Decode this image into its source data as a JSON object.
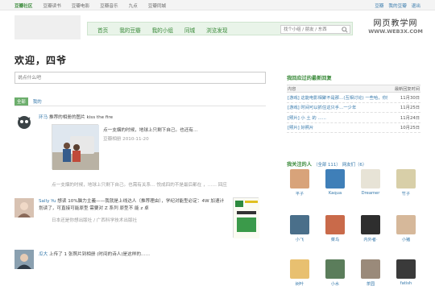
{
  "topbar": {
    "links": [
      "豆瓣社区",
      "豆瓣读书",
      "豆瓣电影",
      "豆瓣音乐",
      "九点",
      "豆瓣同城"
    ],
    "right": [
      "豆瓣",
      "我的豆瓣",
      "退出"
    ]
  },
  "nav": {
    "items": [
      "首页",
      "我的豆瓣",
      "我的小组",
      "同城",
      "浏览发现"
    ],
    "search_placeholder": "找个小组 / 朋友 / 东西"
  },
  "watermark": {
    "cn": "网页教学网",
    "url": "WWW.WEB3X.COM"
  },
  "welcome": "欢迎，四爷",
  "say_placeholder": "说点什么吧",
  "tabs": {
    "all": "全部",
    "mine": "我的"
  },
  "feed": [
    {
      "user": "环马",
      "action": "推荐的相册的图片 kiss the fire",
      "quote": "点一支烟的时候，地球上只剩下自己。也还有…",
      "meta": "豆瓣相册",
      "date": "2010-11-20"
    },
    {
      "caption": "点一支烟的时候，地球上只剩下自己。也需有关系… 悦成四的不是最后都在 ，…… 回应"
    },
    {
      "user": "Sally Yu",
      "action": "想读 10%脑力主義——我就是上线达人（推荐理由），学纪对能型必定：4W 加速计划读了，可直接可能原型 需要对 Z 系列",
      "line2": "原型不 能 z 卓",
      "meta": "日本还是你想出版社 / 广西科学技术出版社"
    },
    {
      "user": "瓜大",
      "action": "上传了 1 张照片到相册 (时间的诗人)是这样的……"
    }
  ],
  "right": {
    "replies_title": "我回应过的最新回复",
    "table_header": [
      "内容",
      "最新回复时间"
    ],
    "rows": [
      {
        "content": "[游戏] 这能电影相聚不是那…(互相讨论) 一些哈，你好？",
        "date": "11月30日"
      },
      {
        "content": "[游戏] 时间可以抓住这只手…一少年",
        "date": "11月25日"
      },
      {
        "content": "[照片] 小 土 的 ……",
        "date": "11月24日"
      },
      {
        "content": "[照片] 好照片",
        "date": "10月25日"
      }
    ],
    "friends_title": "我关注的人",
    "friends_count": "（全部 111）",
    "friends_sub": "网友们（6）",
    "friends": [
      "平子",
      "Kaqua",
      "Dreamer",
      "竹子",
      "小飞",
      "菜鸟",
      "内外者·",
      "小猪",
      "树叶",
      "小水",
      "茶园",
      "fatish"
    ]
  },
  "colors": {
    "brand_green": "#3a8a3a",
    "link_blue": "#3377aa"
  }
}
